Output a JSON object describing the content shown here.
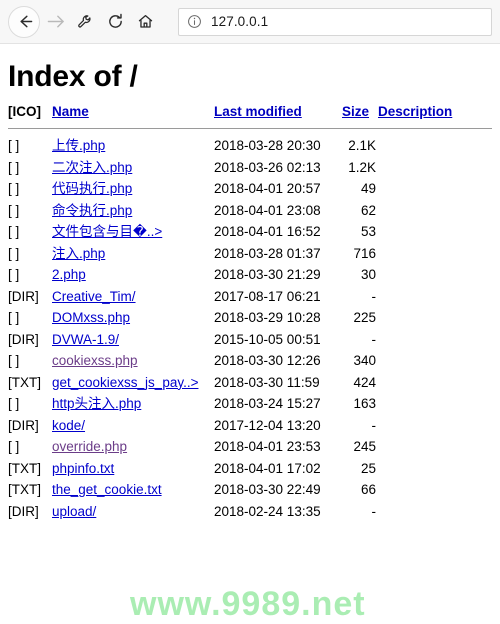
{
  "browser": {
    "back_icon": "arrow-left-icon",
    "forward_icon": "arrow-right-icon",
    "tools_icon": "wrench-icon",
    "reload_icon": "reload-icon",
    "home_icon": "home-icon",
    "url_info_icon": "info-circle-icon",
    "url_value": "127.0.0.1"
  },
  "page": {
    "title": "Index of /",
    "watermark": "www.9989.net"
  },
  "table": {
    "headers": {
      "icon": "[ICO]",
      "name": "Name",
      "last_modified": "Last modified",
      "size": "Size",
      "description": "Description"
    },
    "rows": [
      {
        "icon": "[ ]",
        "name": "上传.php",
        "link_state": "unvisited",
        "modified": "2018-03-28 20:30",
        "size": "2.1K",
        "description": ""
      },
      {
        "icon": "[ ]",
        "name": "二次注入.php",
        "link_state": "unvisited",
        "modified": "2018-03-26 02:13",
        "size": "1.2K",
        "description": ""
      },
      {
        "icon": "[ ]",
        "name": "代码执行.php",
        "link_state": "unvisited",
        "modified": "2018-04-01 20:57",
        "size": "49",
        "description": ""
      },
      {
        "icon": "[ ]",
        "name": "命令执行.php",
        "link_state": "unvisited",
        "modified": "2018-04-01 23:08",
        "size": "62",
        "description": ""
      },
      {
        "icon": "[ ]",
        "name": "文件包含与目�..>",
        "link_state": "unvisited",
        "modified": "2018-04-01 16:52",
        "size": "53",
        "description": ""
      },
      {
        "icon": "[ ]",
        "name": "注入.php",
        "link_state": "unvisited",
        "modified": "2018-03-28 01:37",
        "size": "716",
        "description": ""
      },
      {
        "icon": "[ ]",
        "name": "2.php",
        "link_state": "unvisited",
        "modified": "2018-03-30 21:29",
        "size": "30",
        "description": ""
      },
      {
        "icon": "[DIR]",
        "name": "Creative_Tim/",
        "link_state": "unvisited",
        "modified": "2017-08-17 06:21",
        "size": "-",
        "description": ""
      },
      {
        "icon": "[ ]",
        "name": "DOMxss.php",
        "link_state": "unvisited",
        "modified": "2018-03-29 10:28",
        "size": "225",
        "description": ""
      },
      {
        "icon": "[DIR]",
        "name": "DVWA-1.9/",
        "link_state": "unvisited",
        "modified": "2015-10-05 00:51",
        "size": "-",
        "description": ""
      },
      {
        "icon": "[ ]",
        "name": "cookiexss.php",
        "link_state": "visited",
        "modified": "2018-03-30 12:26",
        "size": "340",
        "description": ""
      },
      {
        "icon": "[TXT]",
        "name": "get_cookiexss_js_pay..>",
        "link_state": "unvisited",
        "modified": "2018-03-30 11:59",
        "size": "424",
        "description": ""
      },
      {
        "icon": "[ ]",
        "name": "http头注入.php",
        "link_state": "unvisited",
        "modified": "2018-03-24 15:27",
        "size": "163",
        "description": ""
      },
      {
        "icon": "[DIR]",
        "name": "kode/",
        "link_state": "unvisited",
        "modified": "2017-12-04 13:20",
        "size": "-",
        "description": ""
      },
      {
        "icon": "[ ]",
        "name": "override.php",
        "link_state": "visited",
        "modified": "2018-04-01 23:53",
        "size": "245",
        "description": ""
      },
      {
        "icon": "[TXT]",
        "name": "phpinfo.txt",
        "link_state": "unvisited",
        "modified": "2018-04-01 17:02",
        "size": "25",
        "description": ""
      },
      {
        "icon": "[TXT]",
        "name": "the_get_cookie.txt",
        "link_state": "unvisited",
        "modified": "2018-03-30 22:49",
        "size": "66",
        "description": ""
      },
      {
        "icon": "[DIR]",
        "name": "upload/",
        "link_state": "unvisited",
        "modified": "2018-02-24 13:35",
        "size": "-",
        "description": ""
      }
    ]
  }
}
